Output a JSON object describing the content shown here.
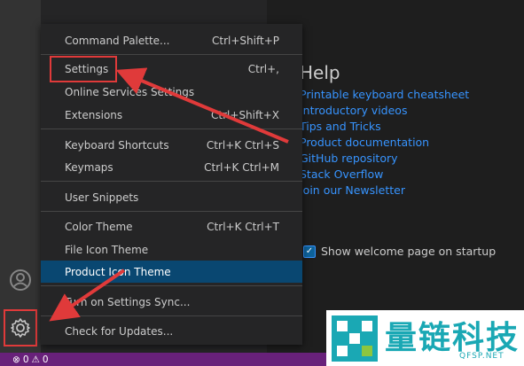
{
  "menu": {
    "items": [
      {
        "label": "Command Palette...",
        "shortcut": "Ctrl+Shift+P"
      },
      {
        "label": "Settings",
        "shortcut": "Ctrl+,"
      },
      {
        "label": "Online Services Settings",
        "shortcut": ""
      },
      {
        "label": "Extensions",
        "shortcut": "Ctrl+Shift+X"
      },
      {
        "label": "Keyboard Shortcuts",
        "shortcut": "Ctrl+K Ctrl+S"
      },
      {
        "label": "Keymaps",
        "shortcut": "Ctrl+K Ctrl+M"
      },
      {
        "label": "User Snippets",
        "shortcut": ""
      },
      {
        "label": "Color Theme",
        "shortcut": "Ctrl+K Ctrl+T"
      },
      {
        "label": "File Icon Theme",
        "shortcut": ""
      },
      {
        "label": "Product Icon Theme",
        "shortcut": ""
      },
      {
        "label": "Turn on Settings Sync...",
        "shortcut": ""
      },
      {
        "label": "Check for Updates...",
        "shortcut": ""
      }
    ]
  },
  "help": {
    "title": "Help",
    "links": [
      "Printable keyboard cheatsheet",
      "Introductory videos",
      "Tips and Tricks",
      "Product documentation",
      "GitHub repository",
      "Stack Overflow",
      "Join our Newsletter"
    ]
  },
  "startup": {
    "label": "Show welcome page on startup",
    "checked": true
  },
  "status": {
    "errors": "0",
    "warnings": "0"
  },
  "watermark": {
    "text": "量链科技",
    "sub": "QFSP.NET"
  },
  "colors": {
    "accent": "#094771",
    "link": "#3794ff",
    "status_bar": "#68217a",
    "highlight": "#e03a3a"
  },
  "icons": {
    "account": "account-icon",
    "manage": "gear-icon",
    "error": "error-icon",
    "warning": "warning-icon",
    "check": "checkmark-icon"
  }
}
